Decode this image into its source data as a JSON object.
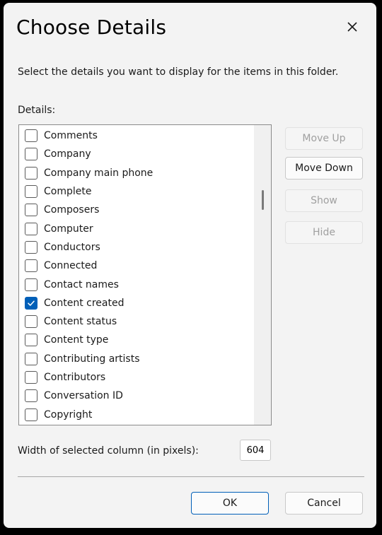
{
  "dialog": {
    "title": "Choose Details",
    "description": "Select the details you want to display for the items in this folder.",
    "details_label": "Details:",
    "close_icon": "close-icon"
  },
  "details_list": [
    {
      "label": "Comments",
      "checked": false
    },
    {
      "label": "Company",
      "checked": false
    },
    {
      "label": "Company main phone",
      "checked": false
    },
    {
      "label": "Complete",
      "checked": false
    },
    {
      "label": "Composers",
      "checked": false
    },
    {
      "label": "Computer",
      "checked": false
    },
    {
      "label": "Conductors",
      "checked": false
    },
    {
      "label": "Connected",
      "checked": false
    },
    {
      "label": "Contact names",
      "checked": false
    },
    {
      "label": "Content created",
      "checked": true
    },
    {
      "label": "Content status",
      "checked": false
    },
    {
      "label": "Content type",
      "checked": false
    },
    {
      "label": "Contributing artists",
      "checked": false
    },
    {
      "label": "Contributors",
      "checked": false
    },
    {
      "label": "Conversation ID",
      "checked": false
    },
    {
      "label": "Copyright",
      "checked": false
    }
  ],
  "side_buttons": {
    "move_up": "Move Up",
    "move_down": "Move Down",
    "show": "Show",
    "hide": "Hide"
  },
  "width": {
    "label": "Width of selected column (in pixels):",
    "value": "604"
  },
  "footer": {
    "ok": "OK",
    "cancel": "Cancel"
  },
  "colors": {
    "accent": "#005fb8",
    "dialog_bg": "#f3f3f3"
  }
}
